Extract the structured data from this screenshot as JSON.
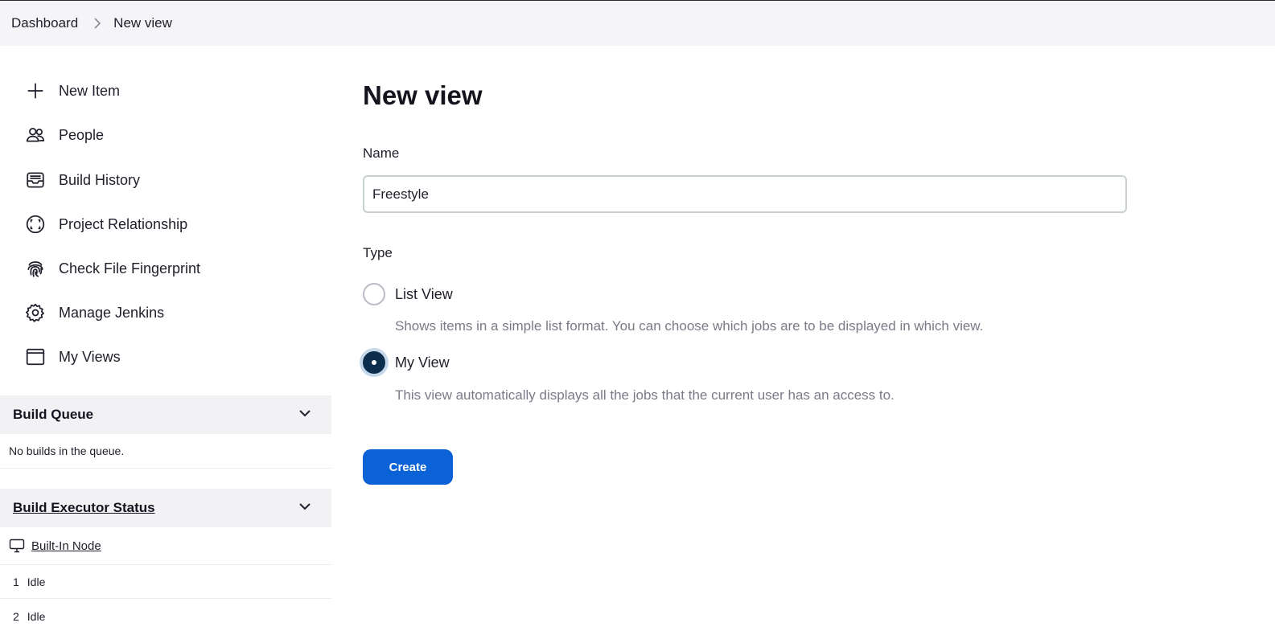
{
  "breadcrumb": {
    "items": [
      "Dashboard",
      "New view"
    ]
  },
  "sidebar": {
    "items": [
      {
        "label": "New Item",
        "icon": "plus-icon"
      },
      {
        "label": "People",
        "icon": "people-icon"
      },
      {
        "label": "Build History",
        "icon": "inbox-icon"
      },
      {
        "label": "Project Relationship",
        "icon": "relationship-icon"
      },
      {
        "label": "Check File Fingerprint",
        "icon": "fingerprint-icon"
      },
      {
        "label": "Manage Jenkins",
        "icon": "gear-icon"
      },
      {
        "label": "My Views",
        "icon": "window-icon"
      }
    ]
  },
  "build_queue": {
    "title": "Build Queue",
    "empty_text": "No builds in the queue."
  },
  "executor_status": {
    "title": "Build Executor Status",
    "node": "Built-In Node",
    "executors": [
      {
        "number": "1",
        "status": "Idle"
      },
      {
        "number": "2",
        "status": "Idle"
      }
    ]
  },
  "form": {
    "title": "New view",
    "name_label": "Name",
    "name_value": "Freestyle",
    "type_label": "Type",
    "options": [
      {
        "label": "List View",
        "description": "Shows items in a simple list format. You can choose which jobs are to be displayed in which view.",
        "checked": false
      },
      {
        "label": "My View",
        "description": "This view automatically displays all the jobs that the current user has an access to.",
        "checked": true
      }
    ],
    "create_label": "Create"
  },
  "colors": {
    "accent": "#0b62d6",
    "radio_checked": "#0b2e4d",
    "topbar_bg": "#f5f5f7"
  }
}
